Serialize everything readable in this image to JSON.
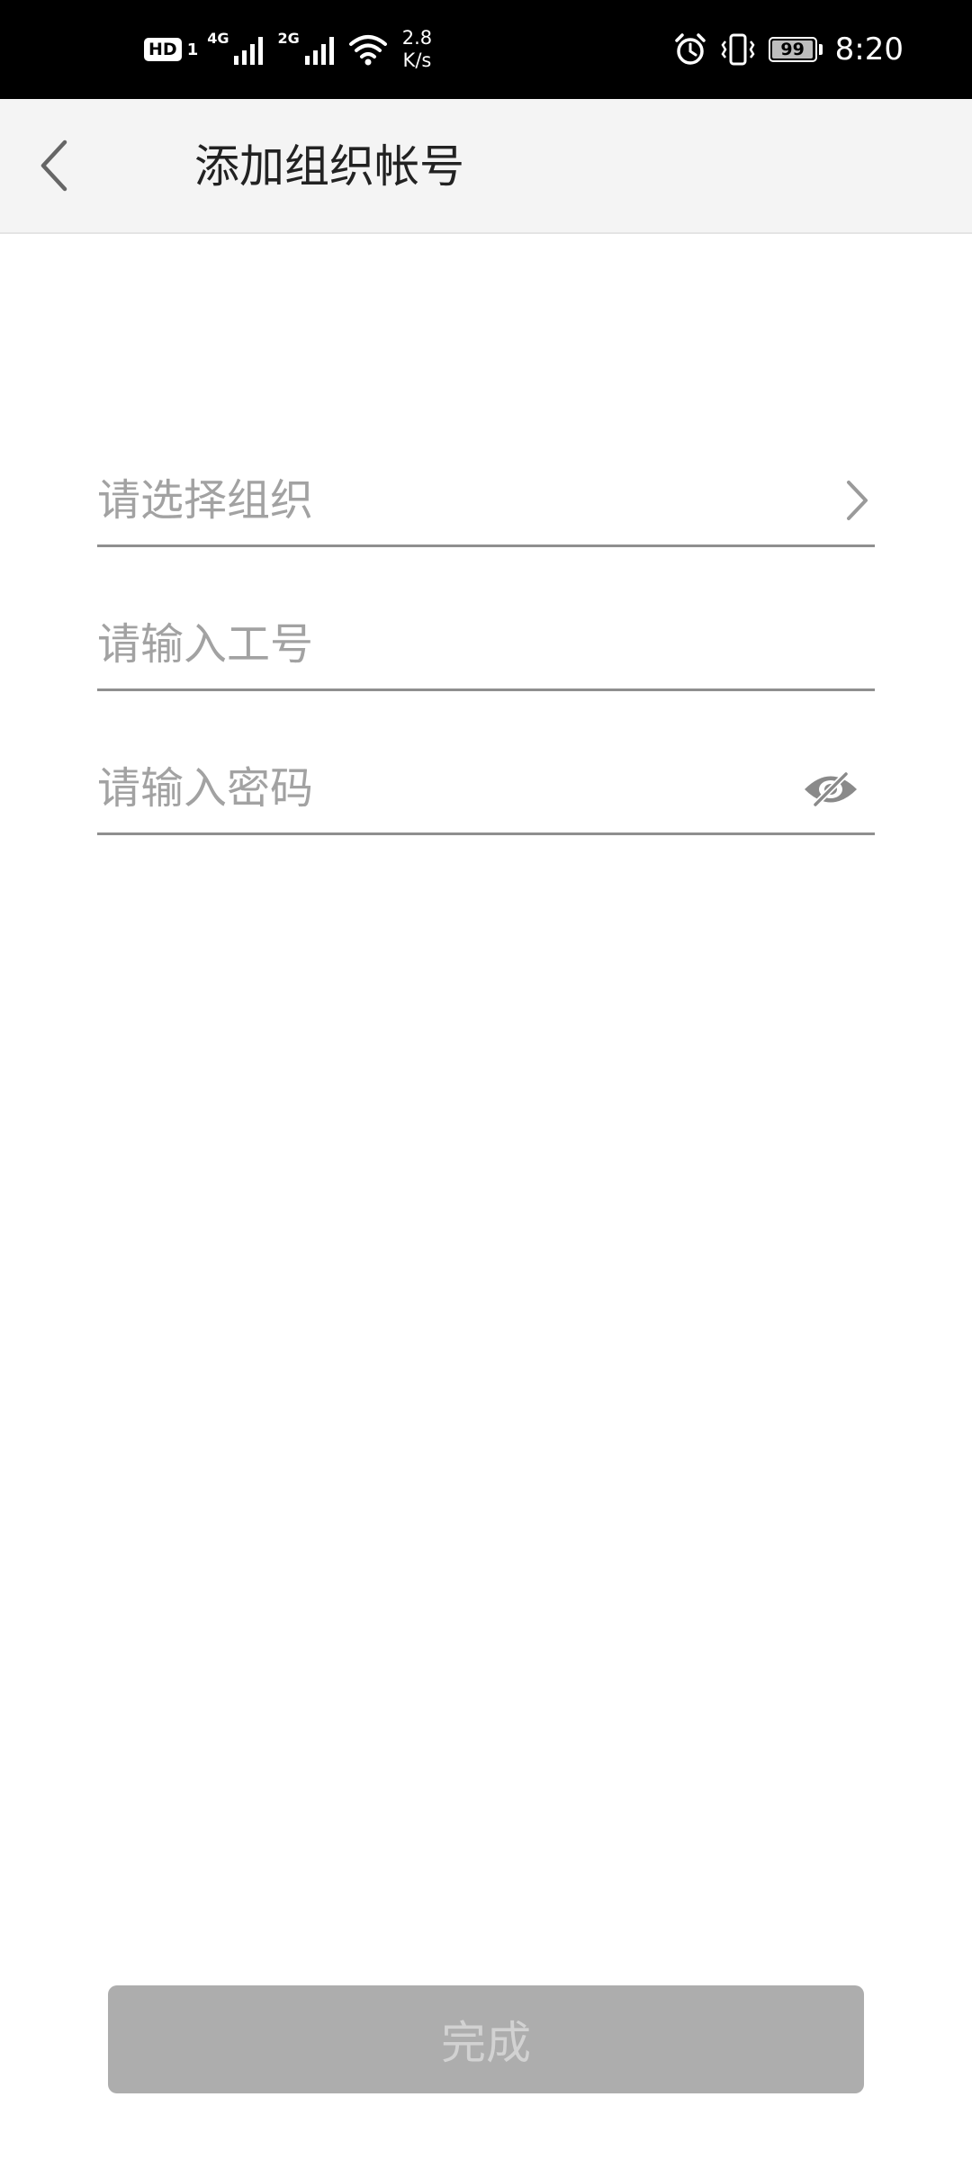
{
  "status_bar": {
    "hd_label": "HD",
    "sim1_label": "1",
    "net1_type": "4G",
    "net2_type": "2G",
    "speed_value": "2.8",
    "speed_unit": "K/s",
    "battery_level": "99",
    "time": "8:20"
  },
  "app_bar": {
    "title": "添加组织帐号"
  },
  "form": {
    "org_placeholder": "请选择组织",
    "employee_id_placeholder": "请输入工号",
    "password_placeholder": "请输入密码"
  },
  "actions": {
    "done_label": "完成"
  },
  "colors": {
    "status_bar_bg": "#000000",
    "app_bar_bg": "#f4f4f4",
    "button_disabled_bg": "#adadad",
    "button_disabled_text": "#d2d2d2",
    "placeholder_text": "#a2a2a2"
  },
  "icons": {
    "back": "chevron-left-icon",
    "org_select": "chevron-right-icon",
    "password_visibility": "eye-off-icon"
  }
}
